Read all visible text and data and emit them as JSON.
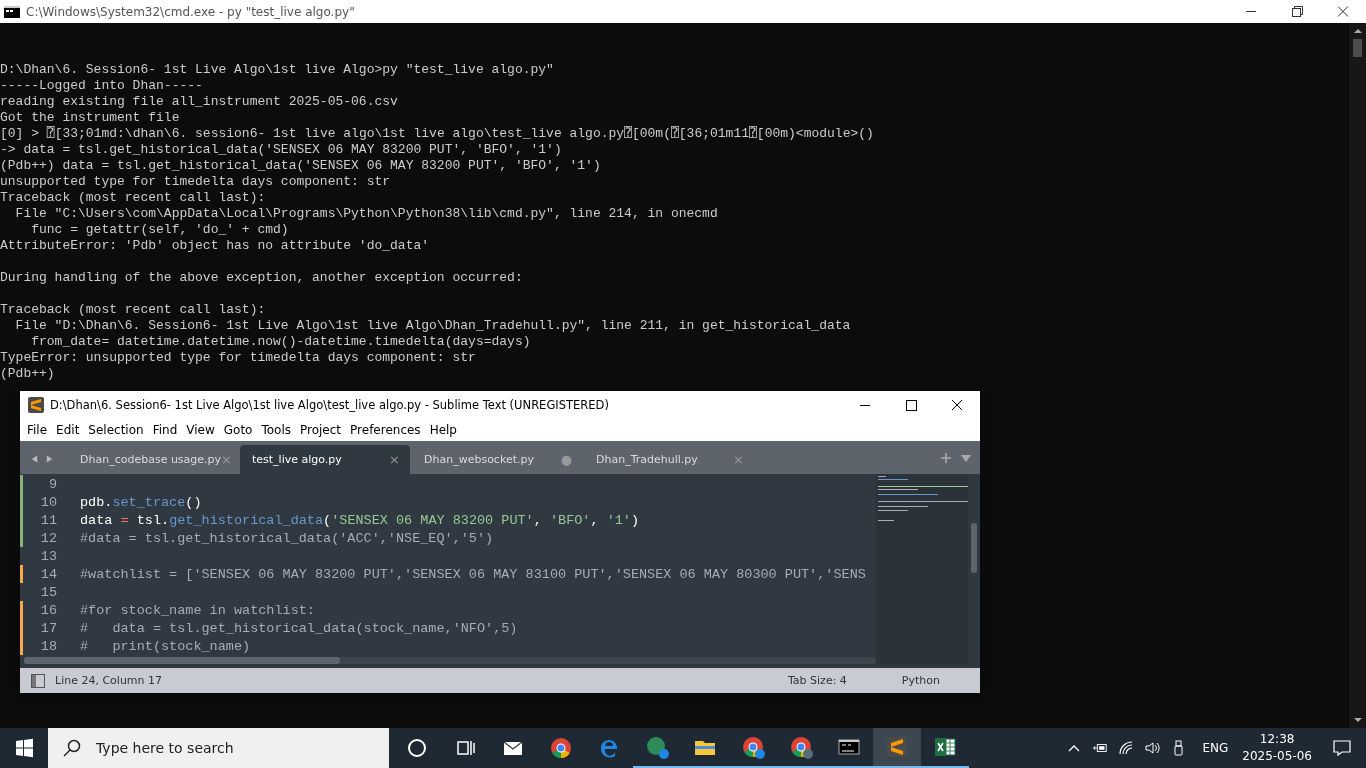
{
  "console": {
    "title": "C:\\Windows\\System32\\cmd.exe - py  \"test_live algo.py\"",
    "lines": [
      {
        "kind": "text",
        "text": "D:\\Dhan\\6. Session6- 1st Live Algo\\1st live Algo>py \"test_live algo.py\""
      },
      {
        "kind": "text",
        "text": "-----Logged into Dhan-----"
      },
      {
        "kind": "text",
        "text": "reading existing file all_instrument 2025-05-06.csv"
      },
      {
        "kind": "text",
        "text": "Got the instrument file"
      },
      {
        "kind": "text",
        "text": "[0] > ⍰[33;01md:\\dhan\\6. session6- 1st live algo\\1st live algo\\test_live algo.py⍰[00m(⍰[36;01m11⍰[00m)<module>()"
      },
      {
        "kind": "text",
        "text": "-> data = tsl.get_historical_data('SENSEX 06 MAY 83200 PUT', 'BFO', '1')"
      },
      {
        "kind": "text",
        "text": "(Pdb++) data = tsl.get_historical_data('SENSEX 06 MAY 83200 PUT', 'BFO', '1')"
      },
      {
        "kind": "text",
        "text": "unsupported type for timedelta days component: str"
      },
      {
        "kind": "text",
        "text": "Traceback (most recent call last):"
      },
      {
        "kind": "text",
        "text": "  File \"C:\\Users\\com\\AppData\\Local\\Programs\\Python\\Python38\\lib\\cmd.py\", line 214, in onecmd"
      },
      {
        "kind": "text",
        "text": "    func = getattr(self, 'do_' + cmd)"
      },
      {
        "kind": "text",
        "text": "AttributeError: 'Pdb' object has no attribute 'do_data'"
      },
      {
        "kind": "blank"
      },
      {
        "kind": "text",
        "text": "During handling of the above exception, another exception occurred:"
      },
      {
        "kind": "blank"
      },
      {
        "kind": "text",
        "text": "Traceback (most recent call last):"
      },
      {
        "kind": "text",
        "text": "  File \"D:\\Dhan\\6. Session6- 1st Live Algo\\1st live Algo\\Dhan_Tradehull.py\", line 211, in get_historical_data"
      },
      {
        "kind": "text",
        "text": "    from_date= datetime.datetime.now()-datetime.timedelta(days=days)"
      },
      {
        "kind": "text",
        "text": "TypeError: unsupported type for timedelta days component: str"
      },
      {
        "kind": "text",
        "text": "(Pdb++)"
      }
    ]
  },
  "editor": {
    "title": "D:\\Dhan\\6. Session6- 1st Live Algo\\1st live Algo\\test_live algo.py - Sublime Text (UNREGISTERED)",
    "menu": [
      "File",
      "Edit",
      "Selection",
      "Find",
      "View",
      "Goto",
      "Tools",
      "Project",
      "Preferences",
      "Help"
    ],
    "tabs": [
      {
        "label": "Dhan_codebase usage.py",
        "selected": false,
        "marker": "×"
      },
      {
        "label": "test_live algo.py",
        "selected": true,
        "marker": "×"
      },
      {
        "label": "Dhan_websocket.py",
        "selected": false,
        "marker": "●"
      },
      {
        "label": "Dhan_Tradehull.py",
        "selected": false,
        "marker": "×"
      }
    ],
    "lines": [
      {
        "number": "9",
        "kind": "added"
      },
      {
        "number": "10",
        "kind": "added",
        "tokens": [
          {
            "kind": "plain",
            "t": "pdb."
          },
          {
            "kind": "func",
            "t": "set_trace"
          },
          {
            "kind": "plain",
            "t": "()"
          }
        ]
      },
      {
        "number": "11",
        "kind": "added",
        "tokens": [
          {
            "kind": "plain",
            "t": "data "
          },
          {
            "kind": "op",
            "t": "="
          },
          {
            "kind": "plain",
            "t": " tsl."
          },
          {
            "kind": "func",
            "t": "get_historical_data"
          },
          {
            "kind": "plain",
            "t": "("
          },
          {
            "kind": "string",
            "t": "'SENSEX 06 MAY 83200 PUT'"
          },
          {
            "kind": "plain",
            "t": ", "
          },
          {
            "kind": "string",
            "t": "'BFO'"
          },
          {
            "kind": "plain",
            "t": ", "
          },
          {
            "kind": "string",
            "t": "'1'"
          },
          {
            "kind": "plain",
            "t": ")"
          }
        ]
      },
      {
        "number": "12",
        "kind": "added",
        "tokens": [
          {
            "kind": "comment",
            "t": "#data = tsl.get_historical_data('ACC','NSE_EQ','5')"
          }
        ]
      },
      {
        "number": "13",
        "kind": "unchanged"
      },
      {
        "number": "14",
        "kind": "modified",
        "tokens": [
          {
            "kind": "comment",
            "t": "#watchlist = ['SENSEX 06 MAY 83200 PUT','SENSEX 06 MAY 83100 PUT','SENSEX 06 MAY 80300 PUT','SENS"
          }
        ]
      },
      {
        "number": "15",
        "kind": "unchanged"
      },
      {
        "number": "16",
        "kind": "modified",
        "tokens": [
          {
            "kind": "comment",
            "t": "#for stock_name in watchlist:"
          }
        ]
      },
      {
        "number": "17",
        "kind": "modified",
        "tokens": [
          {
            "kind": "comment",
            "t": "#   data = tsl.get_historical_data(stock_name,'NFO',5)"
          }
        ]
      },
      {
        "number": "18",
        "kind": "modified",
        "tokens": [
          {
            "kind": "comment",
            "t": "#   print(stock_name)"
          }
        ]
      }
    ],
    "status": {
      "position": "Line 24, Column 17",
      "tab_size": "Tab Size: 4",
      "syntax": "Python"
    }
  },
  "taskbar": {
    "search": {
      "placeholder": "Type here to search"
    },
    "apps": [
      {
        "kind": "cortana",
        "open": false,
        "selected": false
      },
      {
        "kind": "taskview",
        "open": false,
        "selected": false
      },
      {
        "kind": "mail",
        "open": false,
        "selected": false
      },
      {
        "kind": "chrome",
        "open": false,
        "selected": false
      },
      {
        "kind": "edge",
        "open": false,
        "selected": false
      },
      {
        "kind": "greenapp",
        "open": true,
        "selected": false
      },
      {
        "kind": "folder",
        "open": true,
        "selected": false
      },
      {
        "kind": "chrome-badge",
        "open": true,
        "selected": false
      },
      {
        "kind": "chrome-grey",
        "open": true,
        "selected": false
      },
      {
        "kind": "terminal",
        "open": true,
        "selected": false
      },
      {
        "kind": "sublime",
        "open": true,
        "selected": true
      },
      {
        "kind": "excel",
        "open": true,
        "selected": false
      }
    ],
    "language": "ENG",
    "time": "12:38",
    "date": "2025-05-06"
  }
}
